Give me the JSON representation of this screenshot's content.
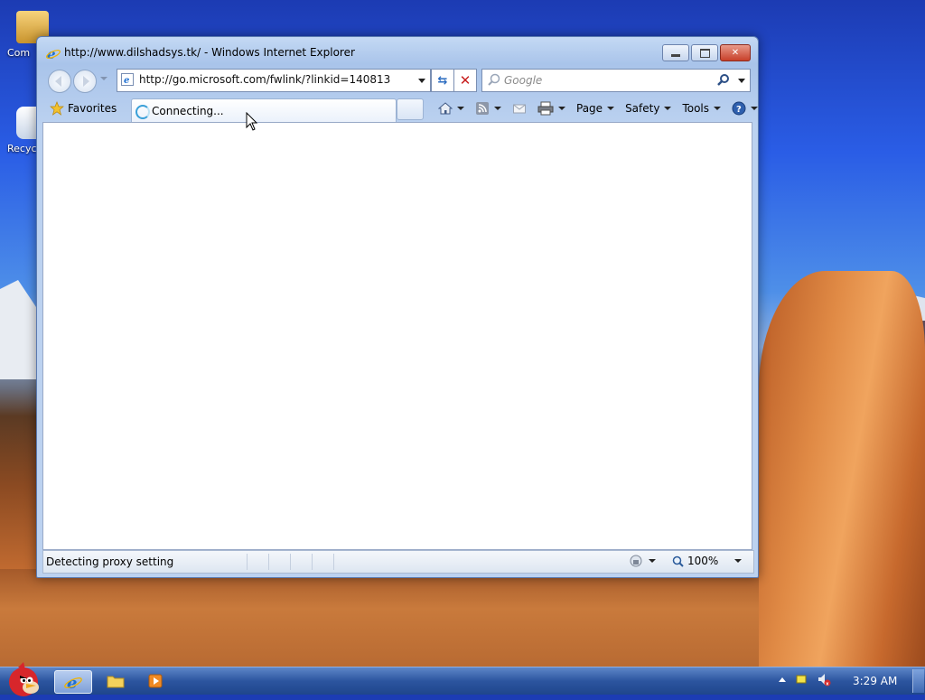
{
  "window": {
    "title": "http://www.dilshadsys.tk/ - Windows Internet Explorer",
    "caption_icons": [
      "minimize-icon",
      "restore-icon",
      "close-icon"
    ]
  },
  "address_bar": {
    "url": "http://go.microsoft.com/fwlink/?linkid=140813"
  },
  "search": {
    "placeholder": "Google"
  },
  "command_bar": {
    "favorites_label": "Favorites",
    "tab_label": "Connecting...",
    "page_label": "Page",
    "safety_label": "Safety",
    "tools_label": "Tools"
  },
  "status_bar": {
    "status_text": "Detecting proxy setting",
    "zoom": "100%"
  },
  "desktop": {
    "icons": [
      {
        "label": "Com"
      },
      {
        "label": "Recyc"
      }
    ]
  },
  "taskbar": {
    "clock": "3:29 AM"
  },
  "colors": {
    "title_bar": "#c4d9f4",
    "close_button": "#c8402a",
    "taskbar": "#2c559f"
  }
}
